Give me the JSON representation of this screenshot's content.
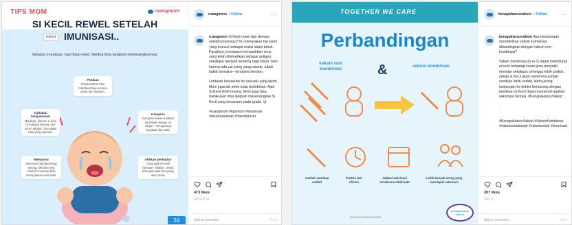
{
  "post1": {
    "media": {
      "brand_left": "TIPS MOM",
      "brand_right": "ruangmom",
      "title_line1": "SI KECIL REWEL SETELAH",
      "title_line2": "IMUNISASI..",
      "edited_label": "Edited",
      "subtitle": "Selepas imunisasi, bayi bisa rewel. Berikut lima langkah menenangkannya:",
      "tips": [
        {
          "title": "Pelukan",
          "text": "Pelukan Mom bisa membuat bayi merasa aman dan nyaman."
        },
        {
          "title": "Ciptakan kenyamanan",
          "text": "Misalnya, biarkan si kecil di ruangan tenang, atur suhu ruangan, dan pakai baju yang nyaman."
        },
        {
          "title": "Kompres",
          "text": "Kompres bekas suntikan imunisasi dengan air dingin—mengurangi bengkak dan sakit."
        },
        {
          "title": "Menyusui",
          "text": "Menyusui membuat bayi tenang. Memberi ASI setelah imunisasi bisa meringankan rasa sakit."
        },
        {
          "title": "Alihkan perhatian",
          "text": "Coba ajak Si Kecil bermain \"cilukba\", misal. Bisa pula ajak bernyanyi atau cerita."
        }
      ],
      "page_badge": "24"
    },
    "header": {
      "username": "ruangmom",
      "follow": "• Follow",
      "more": "..."
    },
    "caption": {
      "username": "ruangmom",
      "paragraphs": [
        "Si Kecil rewel dan demam setelah imunisasi? Itu merupakan hal lazim yang muncul sebagai reaksi alami tubuh. Pasalnya, imunisasi memasukkan virus yang telah dilemahkan sebagai antigen, sekaligus menjadi benteng bagi tubuh. Nah, karena ada zat asing yang masuk, tubuh bakal bereaksi—terutama demam.",
        "Lantaran kerewelan itu sesuatu yang lazim, Mom juga tak perlu risau berlebihan. Ajari Si Kecil lebih tenang, Mom juga bisa melakukan lima langkah menenangkan Si Kecil yang tercantum pada grafis. 😊",
        "#ruangmom #tipsmom #imunisasi #imunisasianak #menditalcuti"
      ]
    },
    "likes": "473 likes",
    "date": "AUGUST 14",
    "comment_placeholder": "Add a comment...",
    "post_label": "Post"
  },
  "post2": {
    "media": {
      "band_text": "TOGETHER WE CARE",
      "title": "Perbandingan",
      "amp": "&",
      "label_non": "vaksin non kombinasi",
      "label_komb": "vaksin kombinasi",
      "bottom_labels": [
        "Jumlah suntikan sedikit",
        "Praktis dan efisien",
        "Jadwal vaksinasi terlaksana lebih baik",
        "Lebih banyak orang yang mendapat vaksinasi"
      ],
      "reg_number": "SRM-DRM-ID/IN/0100 2020",
      "logo_text": "Kenapa Harus Vaksin"
    },
    "header": {
      "username": "kenapaharusvaksin",
      "follow": "• Follow",
      "more": "..."
    },
    "caption": {
      "username": "kenapaharusvaksin",
      "paragraphs": [
        "Apa keuntungan memberikan vaksin kombinasi dibandingkan dengan vaksin non kombinasi?",
        "Vaksin kombinasi (6-in-1) dapat melindungi si kecil terhadap enam jenis penyakit menular sekaligus sehingga lebih praktis, sebab si Kecil akan menerima jumlah suntikan lebih sedikit, lebih jarang kunjungan ke dokter berkurang dengan demikian si Kecil dapat memenuhi jadwal vaksinasi lainnya. #KenapaHarusVaksin",
        "·",
        "·",
        "#KenapaHarusVaksin #VaksinKombinasi #vaksinuntukanak #vaksinuntuk #imunisasi"
      ]
    },
    "likes": "207 likes",
    "date": "JULY 2",
    "comment_placeholder": "Add a comment...",
    "post_label": "Post"
  }
}
